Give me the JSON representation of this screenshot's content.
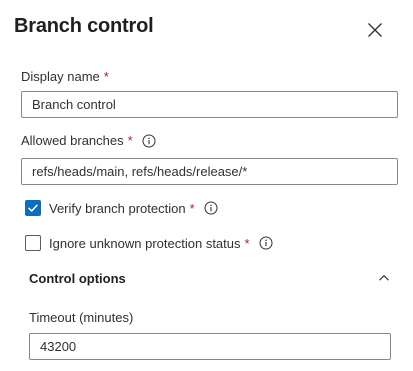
{
  "panel": {
    "title": "Branch control",
    "close_icon": "close-icon"
  },
  "fields": {
    "display_name": {
      "label": "Display name",
      "required": "*",
      "value": "Branch control"
    },
    "allowed_branches": {
      "label": "Allowed branches",
      "required": "*",
      "info_icon": "info-icon",
      "value": "refs/heads/main, refs/heads/release/*"
    },
    "verify_branch_protection": {
      "label": "Verify branch protection",
      "required": "*",
      "checked": true,
      "info_icon": "info-icon"
    },
    "ignore_unknown_status": {
      "label": "Ignore unknown protection status",
      "required": "*",
      "checked": false,
      "info_icon": "info-icon"
    }
  },
  "control_options": {
    "label": "Control options",
    "expanded": true,
    "timeout": {
      "label": "Timeout (minutes)",
      "value": "43200"
    }
  },
  "colors": {
    "accent": "#0f6cbd",
    "required": "#a4262c",
    "border": "#8a8886"
  }
}
